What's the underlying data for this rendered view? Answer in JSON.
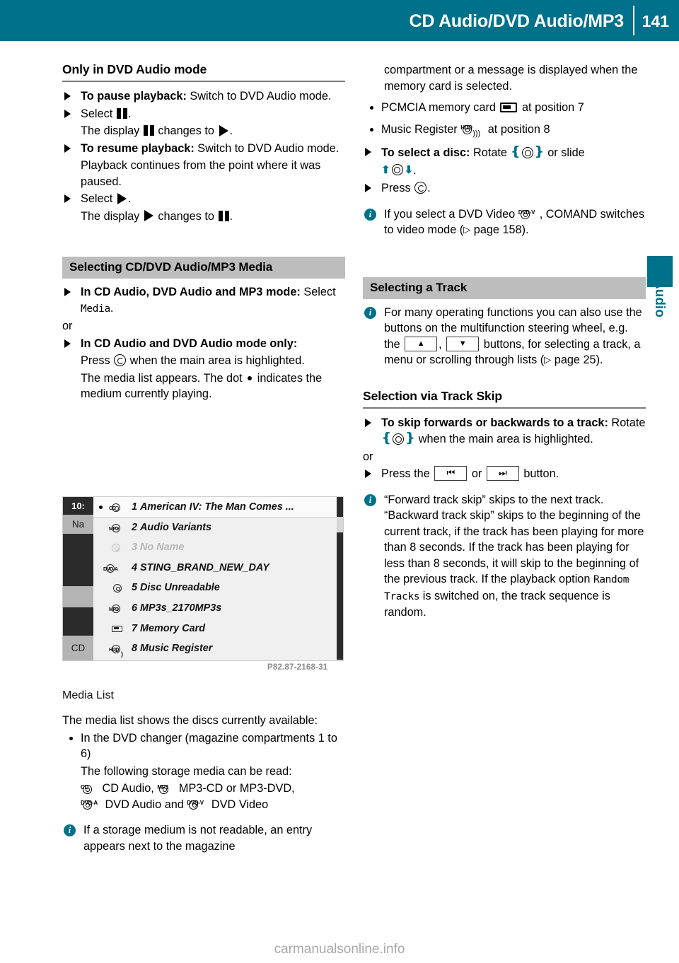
{
  "header": {
    "title": "CD Audio/DVD Audio/MP3",
    "page_number": "141"
  },
  "side_tab": {
    "label": "Audio"
  },
  "left_column": {
    "section1_title": "Only in DVD Audio mode",
    "step1_bold": "To pause playback:",
    "step1_rest": " Switch to DVD Audio mode.",
    "step2_prefix": "Select ",
    "step2_suffix": ".",
    "step2_sub_a": "The display ",
    "step2_sub_b": " changes to ",
    "step2_sub_c": ".",
    "step3_bold": "To resume playback:",
    "step3_rest": " Switch to DVD Audio mode.",
    "step3_sub": "Playback continues from the point where it was paused.",
    "step4_prefix": "Select ",
    "step4_suffix": ".",
    "step4_sub_a": "The display ",
    "step4_sub_b": " changes to ",
    "step4_sub_c": ".",
    "section2_title": "Selecting CD/DVD Audio/MP3 Media",
    "s2_step1_bold": "In CD Audio, DVD Audio and MP3 mode:",
    "s2_step1_rest": " Select ",
    "s2_step1_ui": "Media",
    "s2_step1_end": ".",
    "or_label": "or",
    "s2_step2_bold": "In CD Audio and DVD Audio mode only:",
    "s2_step2_line1_a": "Press ",
    "s2_step2_line1_b": " when the main area is highlighted.",
    "s2_step2_line2_a": "The media list appears. The dot ",
    "s2_step2_line2_b": " indicates the medium currently playing.",
    "image_code": "P82.87-2168-31",
    "image_caption": "Media List",
    "para1": "The media list shows the discs currently available:",
    "bullet1_line1": "In the DVD changer (magazine compartments 1 to 6)",
    "bullet1_line2": "The following storage media can be read:",
    "media_cd_label": " CD Audio, ",
    "media_mp3_label": " MP3-CD or MP3-DVD,",
    "media_dvda_label": " DVD Audio and ",
    "media_dvdv_label": " DVD Video",
    "note1": "If a storage medium is not readable, an entry appears next to the magazine"
  },
  "right_column": {
    "note1_cont": "compartment or a message is displayed when the memory card is selected.",
    "bullet_pcmcia_a": "PCMCIA memory card ",
    "bullet_pcmcia_b": " at position 7",
    "bullet_music_a": "Music Register ",
    "bullet_music_b": " at position 8",
    "step_select_bold": "To select a disc:",
    "step_select_rest_a": " Rotate ",
    "step_select_rest_b": " or slide ",
    "step_select_rest_c": ".",
    "step_press_a": "Press ",
    "step_press_b": ".",
    "note_dvdvideo_a": "If you select a DVD Video ",
    "note_dvdvideo_b": ", COMAND switches to video mode (",
    "note_dvdvideo_page": " page 158).",
    "section_track_title": "Selecting a Track",
    "note_mfsw_a": "For many operating functions you can also use the buttons on the multifunction steering wheel, e.g. the ",
    "note_mfsw_up": "▲",
    "note_mfsw_mid": ", ",
    "note_mfsw_down": "▼",
    "note_mfsw_b": " buttons, for selecting a track, a menu or scrolling through lists (",
    "note_mfsw_page": " page 25).",
    "subsection_skip_title": "Selection via Track Skip",
    "step_skip_bold": "To skip forwards or backwards to a track:",
    "step_skip_rest_a": " Rotate ",
    "step_skip_rest_b": " when the main area is highlighted.",
    "or_label": "or",
    "step_button_a": "Press the ",
    "step_button_prev": "⏮",
    "step_button_mid": " or ",
    "step_button_next": "⏭",
    "step_button_b": " button.",
    "note_skip_a": "“Forward track skip” skips to the next track. “Backward track skip” skips to the beginning of the current track, if the track has been playing for more than 8 seconds. If the track has been playing for less than 8 seconds, it will skip to the beginning of the previous track. If the playback option ",
    "note_skip_ui": "Random Tracks",
    "note_skip_b": " is switched on, the track sequence is random."
  },
  "comand_screenshot": {
    "status_time": "10:",
    "nav_label": "Na",
    "cd_label": "CD",
    "rows": [
      {
        "num": "1",
        "title": "American IV: The Man Comes ...",
        "tag": "CD",
        "playing": true,
        "dim": false
      },
      {
        "num": "2",
        "title": "Audio Variants",
        "tag": "MP3",
        "playing": false,
        "dim": false
      },
      {
        "num": "3",
        "title": "No Name",
        "tag": "",
        "playing": false,
        "dim": true
      },
      {
        "num": "4",
        "title": "STING_BRAND_NEW_DAY",
        "tag": "DVD-A",
        "playing": false,
        "dim": false
      },
      {
        "num": "5",
        "title": "Disc Unreadable",
        "tag": "plain",
        "playing": false,
        "dim": false
      },
      {
        "num": "6",
        "title": "MP3s_2170MP3s",
        "tag": "MP3",
        "playing": false,
        "dim": false
      },
      {
        "num": "7",
        "title": "Memory Card",
        "tag": "card",
        "playing": false,
        "dim": false
      },
      {
        "num": "8",
        "title": "Music Register",
        "tag": "HDD",
        "playing": false,
        "dim": false
      }
    ]
  },
  "footer": {
    "watermark": "carmanualsonline.info"
  },
  "colors": {
    "accent_teal": "#00718A",
    "section_header_gray": "#bdbdbd",
    "rule_gray": "#7b7b7b"
  }
}
